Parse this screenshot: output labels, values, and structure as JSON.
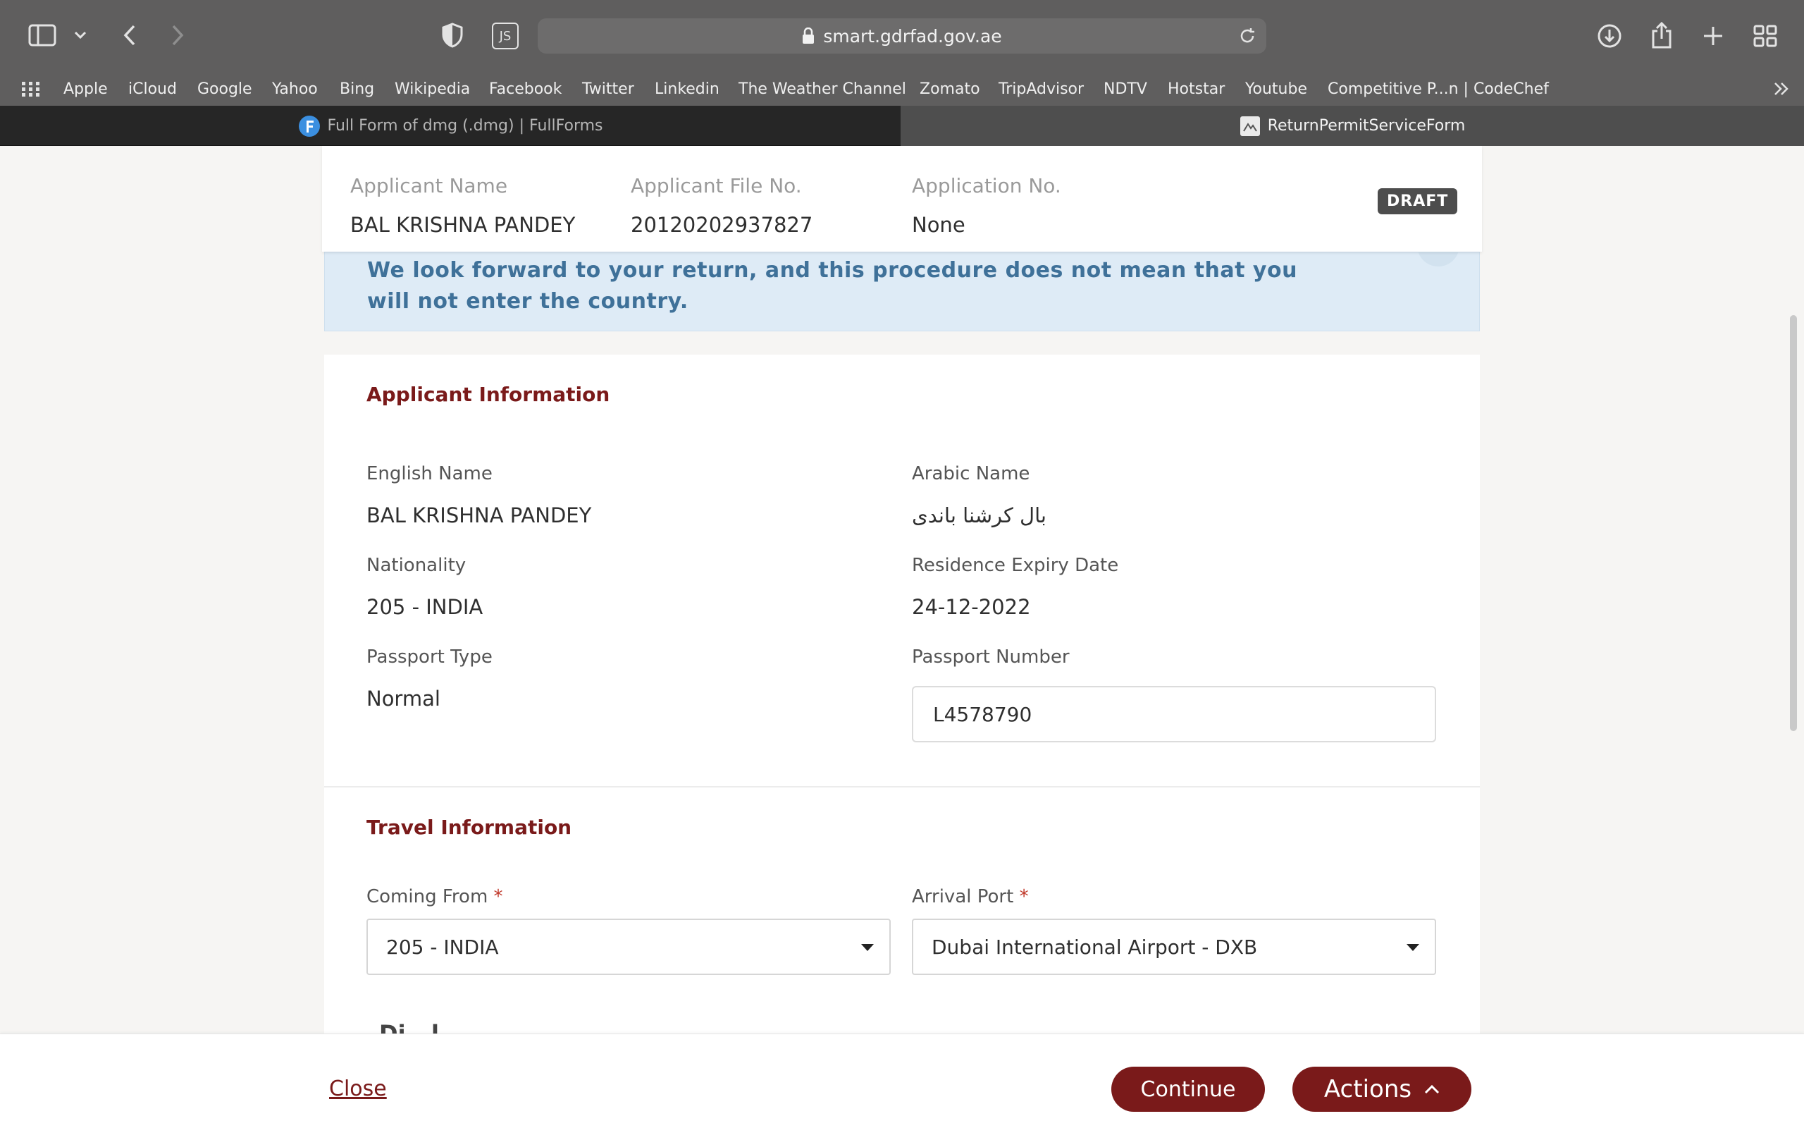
{
  "browser": {
    "url": "smart.gdrfad.gov.ae",
    "bookmarks": [
      "Apple",
      "iCloud",
      "Google",
      "Yahoo",
      "Bing",
      "Wikipedia",
      "Facebook",
      "Twitter",
      "Linkedin",
      "The Weather Channel",
      "Zomato",
      "TripAdvisor",
      "NDTV",
      "Hotstar",
      "Youtube",
      "Competitive P...n | CodeChef"
    ],
    "extension_label": "JS",
    "tabs": [
      {
        "title": "Full Form of dmg (.dmg) | FullForms",
        "active": false
      },
      {
        "title": "ReturnPermitServiceForm",
        "active": true
      }
    ]
  },
  "summary": {
    "applicant_name_label": "Applicant Name",
    "applicant_name": "BAL KRISHNA PANDEY",
    "file_no_label": "Applicant File No.",
    "file_no": "20120202937827",
    "application_no_label": "Application No.",
    "application_no": "None",
    "status": "DRAFT"
  },
  "notice": {
    "text": "We look forward to your return, and this procedure does not mean that you will not enter the country."
  },
  "applicant_info": {
    "title": "Applicant Information",
    "english_name_label": "English Name",
    "english_name": "BAL KRISHNA PANDEY",
    "arabic_name_label": "Arabic Name",
    "arabic_name": "بال كرشنا باندى",
    "nationality_label": "Nationality",
    "nationality": "205 - INDIA",
    "residence_expiry_label": "Residence Expiry Date",
    "residence_expiry": "24-12-2022",
    "passport_type_label": "Passport Type",
    "passport_type": "Normal",
    "passport_number_label": "Passport Number",
    "passport_number": "L4578790"
  },
  "travel_info": {
    "title": "Travel Information",
    "coming_from_label": "Coming From",
    "coming_from": "205 - INDIA",
    "arrival_port_label": "Arrival Port",
    "arrival_port": "Dubai International Airport - DXB",
    "required_mark": "*",
    "partial_next_label": "Di...l..."
  },
  "footer": {
    "close_label": "Close",
    "continue_label": "Continue",
    "actions_label": "Actions"
  },
  "colors": {
    "brand": "#7a1a1a",
    "notice_bg": "#deebf6",
    "notice_text": "#3f7199",
    "chrome": "#5f5e5e"
  }
}
